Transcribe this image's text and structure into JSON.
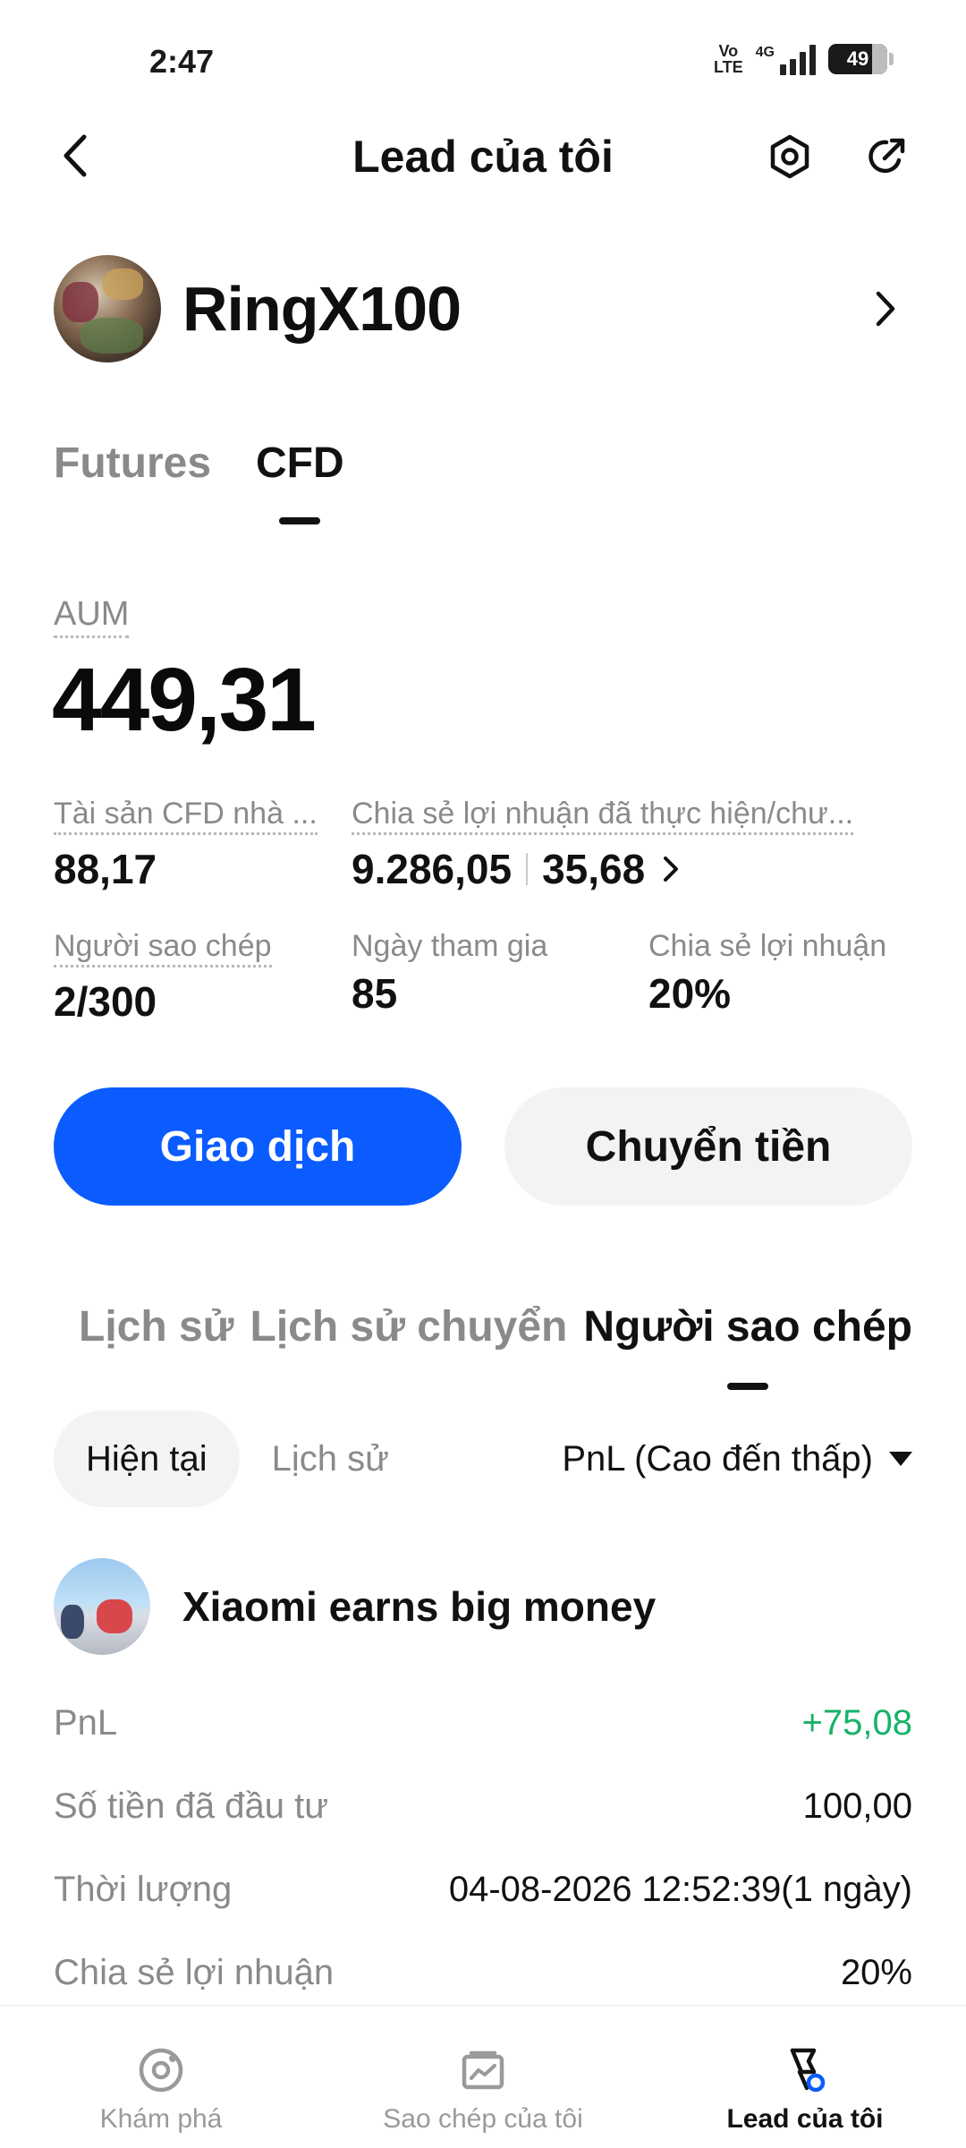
{
  "status_bar": {
    "time": "2:47",
    "volte": "Vo LTE",
    "network": "4G",
    "battery": "49"
  },
  "header": {
    "title": "Lead của tôi"
  },
  "profile": {
    "name": "RingX100"
  },
  "product_tabs": [
    {
      "label": "Futures",
      "active": false
    },
    {
      "label": "CFD",
      "active": true
    }
  ],
  "aum": {
    "label": "AUM",
    "value": "449,31"
  },
  "stats": {
    "cfd_assets": {
      "label": "Tài sản CFD nhà ...",
      "value": "88,17"
    },
    "profit_share_realized": {
      "label": "Chia sẻ lợi nhuận đã thực hiện/chư...",
      "realized": "9.286,05",
      "unrealized": "35,68"
    },
    "copiers": {
      "label": "Người sao chép",
      "value": "2/300"
    },
    "join_days": {
      "label": "Ngày tham gia",
      "value": "85"
    },
    "profit_share": {
      "label": "Chia sẻ lợi nhuận",
      "value": "20%"
    }
  },
  "actions": {
    "trade": "Giao dịch",
    "transfer": "Chuyển tiền"
  },
  "section_tabs": [
    {
      "label": "Lịch sử",
      "active": false
    },
    {
      "label": "Lịch sử chuyển",
      "active": false
    },
    {
      "label": "Người sao chép",
      "active": true
    }
  ],
  "filters": {
    "current": "Hiện tại",
    "history": "Lịch sử",
    "sort": "PnL (Cao đến thấp)"
  },
  "follower": {
    "name": "Xiaomi earns big money",
    "rows": [
      {
        "label": "PnL",
        "value": "+75,08"
      },
      {
        "label": "Số tiền đã đầu tư",
        "value": "100,00"
      },
      {
        "label": "Thời lượng",
        "value": "04-08-2026 12:52:39(1 ngày)"
      },
      {
        "label": "Chia sẻ lợi nhuận",
        "value": "20%"
      }
    ]
  },
  "bottom_nav": [
    {
      "label": "Khám phá",
      "icon": "explore-icon",
      "active": false
    },
    {
      "label": "Sao chép của tôi",
      "icon": "chart-card-icon",
      "active": false
    },
    {
      "label": "Lead của tôi",
      "icon": "lead-flag-icon",
      "active": true
    }
  ],
  "colors": {
    "primary": "#0b5cff",
    "positive": "#17b26a",
    "muted": "#8a8a8a"
  }
}
